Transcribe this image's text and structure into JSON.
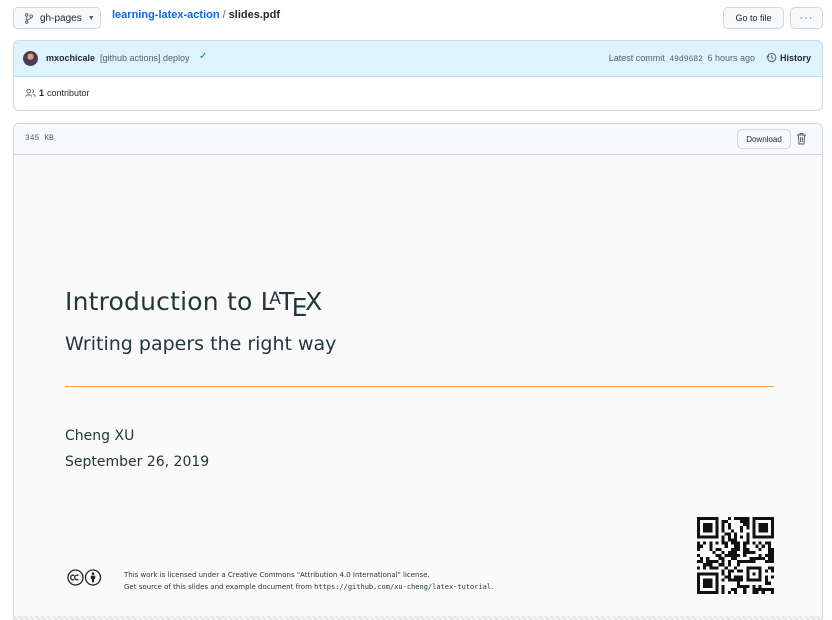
{
  "topbar": {
    "branch": "gh-pages",
    "repo": "learning-latex-action",
    "separator": "/",
    "file": "slides.pdf",
    "go_to_file": "Go to file",
    "more": "···"
  },
  "commit": {
    "author": "mxochicale",
    "message": "[github actions] deploy",
    "status": "success",
    "latest_label": "Latest commit",
    "sha": "49d9682",
    "time": "6 hours ago",
    "history": "History",
    "contributors_count": "1",
    "contributors_label": "contributor"
  },
  "file": {
    "size": "345 KB",
    "download": "Download"
  },
  "slide": {
    "title_prefix": "Introduction to",
    "title_logo": "LaTeX",
    "logo": {
      "l": "L",
      "a": "A",
      "t": "T",
      "e": "E",
      "x": "X"
    },
    "subtitle": "Writing papers the right way",
    "author": "Cheng XU",
    "date": "September 26, 2019",
    "license_line1": "This work is licensed under a Creative Commons \"Attribution 4.0 International\" license.",
    "license_line2_prefix": "Get source of this slides and example document from",
    "license_url": "https://github.com/xu-cheng/latex-tutorial",
    "license_end": "."
  },
  "colors": {
    "link": "#0969da",
    "commit_bg": "#ddf4ff",
    "success": "#1a7f37",
    "slide_text": "#23373b",
    "slide_rule": "#eb811b"
  }
}
